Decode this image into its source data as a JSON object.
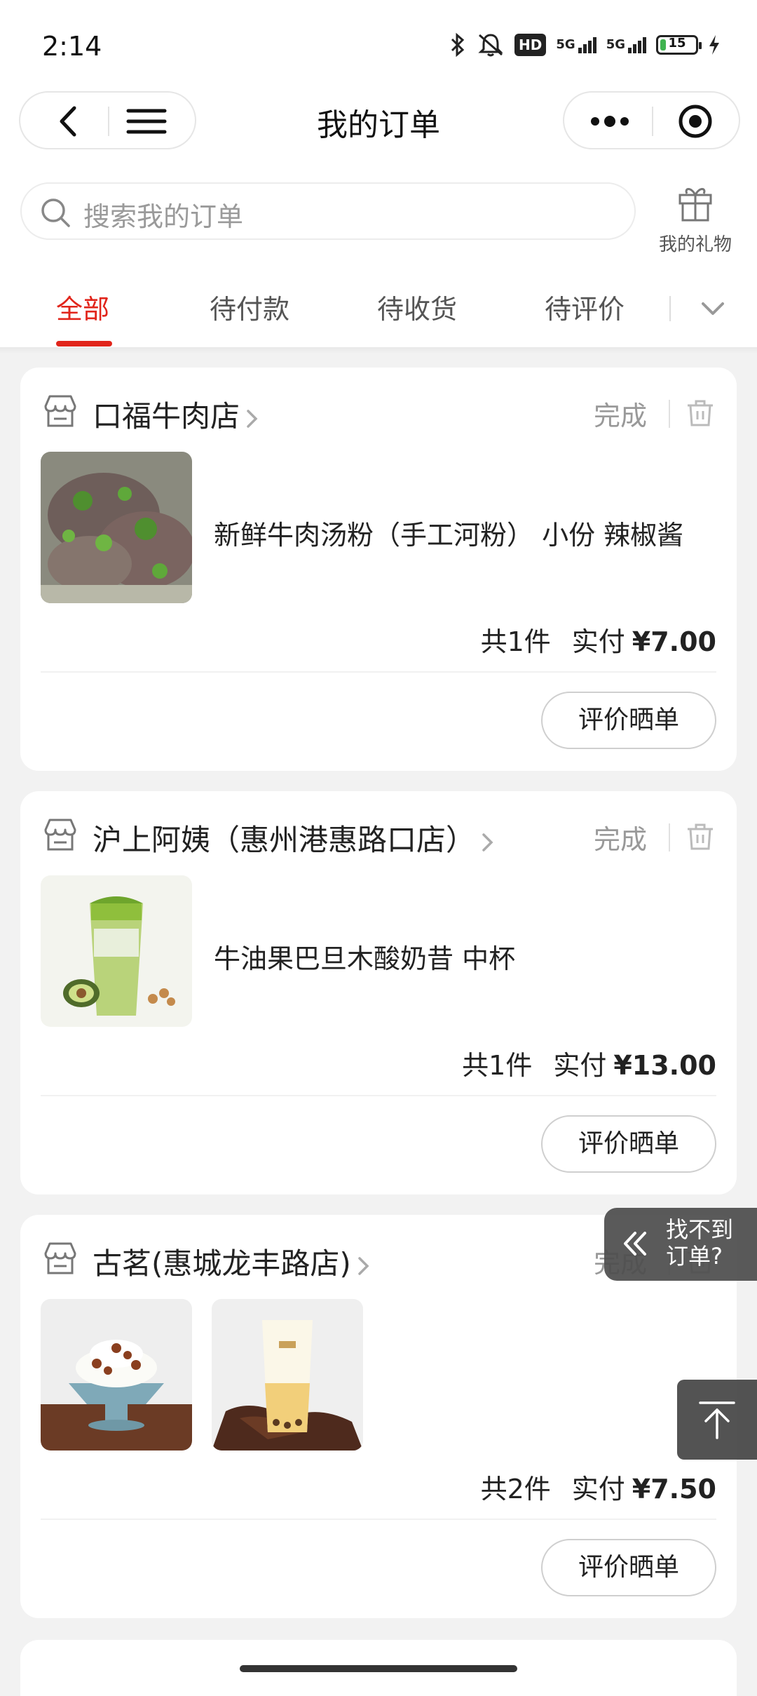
{
  "status_bar": {
    "time": "2:14",
    "hd": "HD",
    "net1": "5G",
    "net2": "5G",
    "battery": "15"
  },
  "header": {
    "title": "我的订单"
  },
  "search": {
    "placeholder": "搜索我的订单"
  },
  "gift": {
    "label": "我的礼物"
  },
  "tabs": [
    {
      "label": "全部",
      "active": true
    },
    {
      "label": "待付款",
      "active": false
    },
    {
      "label": "待收货",
      "active": false
    },
    {
      "label": "待评价",
      "active": false
    }
  ],
  "orders": [
    {
      "store": "口福牛肉店",
      "status": "完成",
      "item": "新鲜牛肉汤粉（手工河粉） 小份 辣椒酱",
      "count": "共1件",
      "paid_label": "实付",
      "price": "¥7.00",
      "action": "评价晒单"
    },
    {
      "store": "沪上阿姨（惠州港惠路口店）",
      "status": "完成",
      "item": "牛油果巴旦木酸奶昔 中杯",
      "count": "共1件",
      "paid_label": "实付",
      "price": "¥13.00",
      "action": "评价晒单"
    },
    {
      "store": "古茗(惠城龙丰路店)",
      "status": "完成",
      "item": "",
      "count": "共2件",
      "paid_label": "实付",
      "price": "¥7.50",
      "action": "评价晒单"
    }
  ],
  "floating": {
    "find_order": "找不到订单?"
  },
  "colors": {
    "accent": "#e1251b",
    "background": "#f2f2f2",
    "float_bg": "#4e4e4e"
  }
}
